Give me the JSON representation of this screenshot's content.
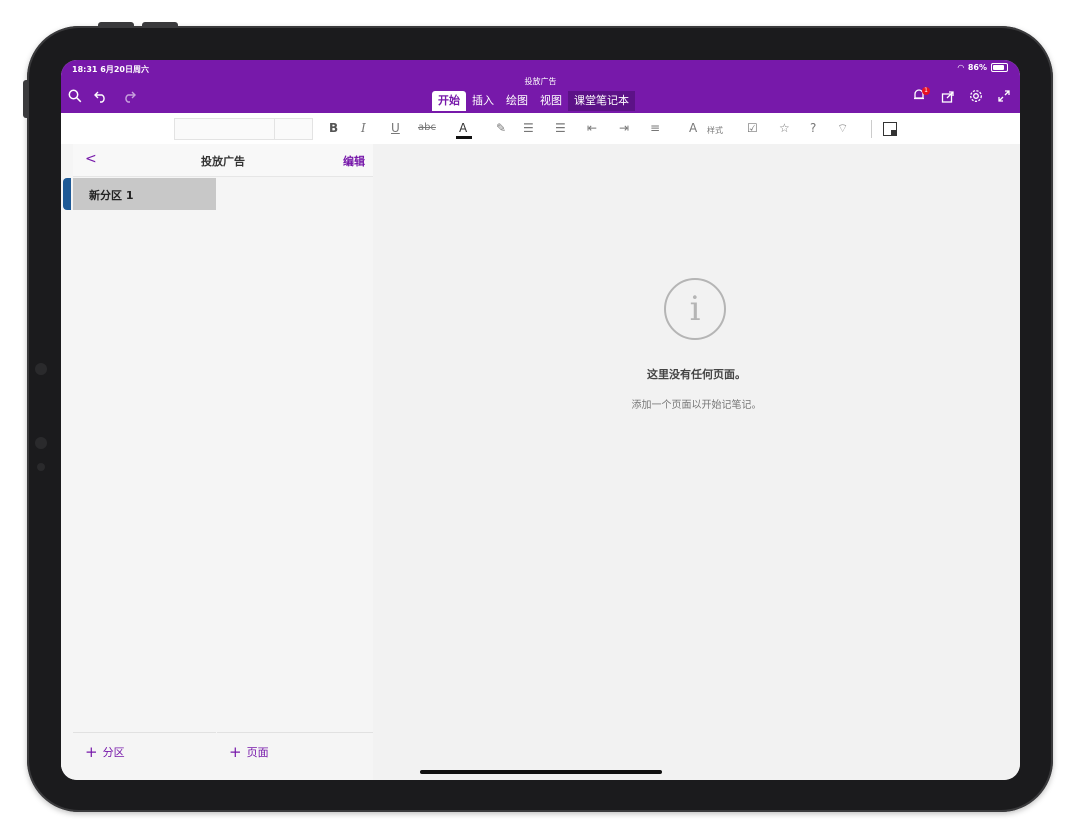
{
  "status_bar": {
    "time": "18:31 6月20日周六",
    "battery": "86%"
  },
  "app": {
    "doc_title": "投放广告"
  },
  "tabs": [
    {
      "label": "开始"
    },
    {
      "label": "插入"
    },
    {
      "label": "绘图"
    },
    {
      "label": "视图"
    },
    {
      "label": "课堂笔记本"
    }
  ],
  "notifications": {
    "count": "1"
  },
  "ribbon": {
    "bold": "B",
    "italic": "I",
    "underline": "U",
    "strike": "abc",
    "font_color": "A",
    "styles_label": "样式",
    "help": "?"
  },
  "navigation": {
    "back": "<",
    "title": "投放广告",
    "edit": "编辑"
  },
  "sections": [
    {
      "label": "新分区 1",
      "active": true
    }
  ],
  "actions": {
    "add_section": "分区",
    "add_page": "页面",
    "plus": "+"
  },
  "empty_state": {
    "title": "这里没有任何页面。",
    "subtitle": "添加一个页面以开始记笔记。",
    "icon_glyph": "i"
  },
  "colors": {
    "brand": "#7719aa",
    "section_accent": "#1f5a96"
  }
}
